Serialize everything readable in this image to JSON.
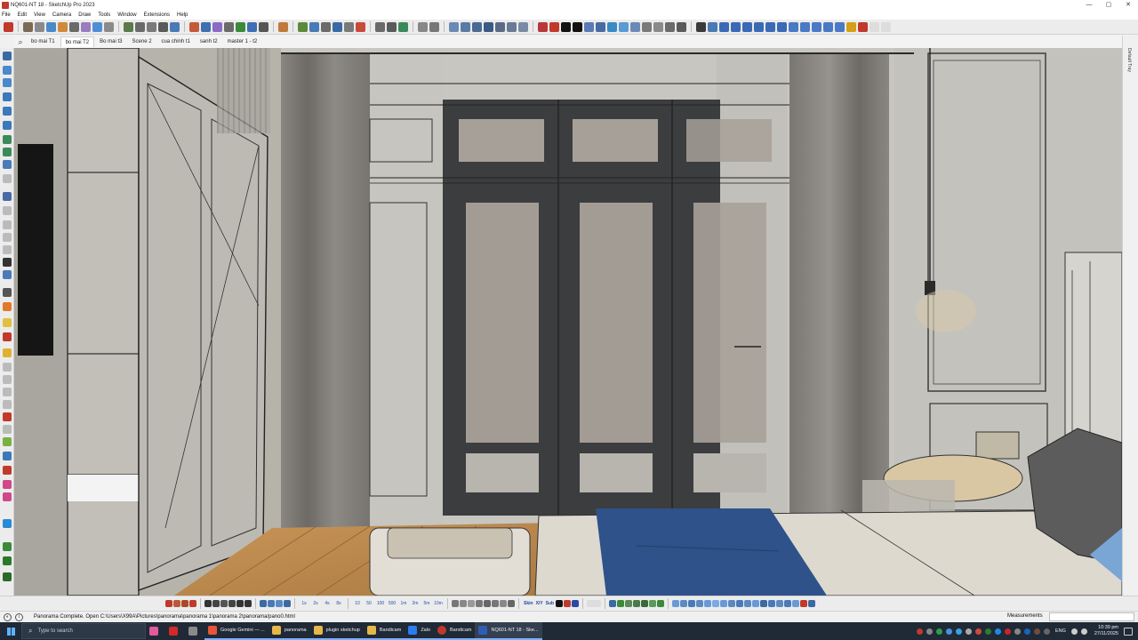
{
  "window": {
    "title": "NQ601-NT 18 - SketchUp Pro 2023",
    "controls": [
      "—",
      "▢",
      "✕"
    ]
  },
  "menu": [
    "File",
    "Edit",
    "View",
    "Camera",
    "Draw",
    "Tools",
    "Window",
    "Extensions",
    "Help"
  ],
  "scenes": {
    "tabs": [
      "bo mai T1",
      "bo mai T2",
      "Bo mai t3",
      "Scene 2",
      "cua chinh t1",
      "sanh t2",
      "master 1 - t2"
    ],
    "active_index": 1
  },
  "default_tray": {
    "label": "Default Tray"
  },
  "bottom_toolbar": {
    "ticks": [
      "1s",
      "2s",
      "4s",
      "8s",
      "10",
      "50",
      "100",
      "500",
      "1m",
      "2m",
      "5m",
      "10m"
    ],
    "labels": [
      "Skin",
      "X/Y",
      "Sub"
    ]
  },
  "status": {
    "message": "Panorama Complete. Open C:\\Users\\X99A\\Pictures\\panorama\\panorama 1\\panorama 2\\panorama/pano0.html",
    "measurements_label": "Measurements",
    "measurements_value": ""
  },
  "taskbar": {
    "search_placeholder": "Type to search",
    "apps": [
      {
        "label": "Google Gemini — ...",
        "color": "#e8553b",
        "state": "running"
      },
      {
        "label": "panorama",
        "color": "#e6b84a",
        "state": "running"
      },
      {
        "label": "plugin sketchup",
        "color": "#e6b84a",
        "state": "running"
      },
      {
        "label": "Bandicam",
        "color": "#e6b84a",
        "state": "running"
      },
      {
        "label": "Zalo",
        "color": "#2a7cf3",
        "state": "running"
      },
      {
        "label": "Bandicam",
        "color": "#c0392b",
        "state": "running"
      },
      {
        "label": "NQ601-NT 18 - Ske...",
        "color": "#2e5db5",
        "state": "active"
      }
    ],
    "language": "ENG",
    "time": "10:39 pm",
    "date": "27/11/2025"
  },
  "colors": {
    "accent": "#2553a8",
    "viewport_wall": "#b9b6ae",
    "door_frame": "#3c3d3f",
    "blanket": "#2e5289",
    "floor": "#c08a4e"
  }
}
